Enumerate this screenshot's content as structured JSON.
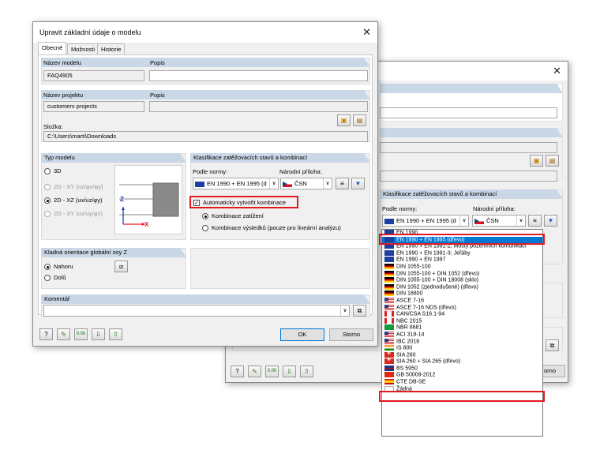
{
  "front": {
    "title": "Upravit základní údaje o modelu",
    "tabs": [
      "Obecné",
      "Možnosti",
      "Historie"
    ],
    "model_name_label": "Název modelu",
    "model_name_value": "FAQ4905",
    "description_label": "Popis",
    "project_name_label": "Název projektu",
    "project_name_value": "customers projects",
    "project_desc_label": "Popis",
    "folder_label": "Složka:",
    "folder_value": "C:\\Users\\marti\\Downloads",
    "model_type_header": "Typ modelu",
    "model_types": [
      "3D",
      "2D - XY (uₓ/uᵧ/φᵣ)",
      "2D - XZ (uₓ/uₓ/φᵧ)",
      "2D - XY (uₓ/uᵧ/φᵣ)"
    ],
    "model_types_display": [
      "3D",
      "2D - XY (uz/φx/φy)",
      "2D - XZ (ux/uz/φy)",
      "2D - XY (ux/uy/φz)"
    ],
    "classification_header": "Klasifikace zatěžovacích stavů a kombinací",
    "standard_label": "Podle normy:",
    "standard_value": "EN 1990 + EN 1995 (d",
    "annex_label": "Národní příloha:",
    "annex_value": "ČSN",
    "auto_combo_label": "Automaticky vytvořit kombinace",
    "combo_options": [
      "Kombinace zatížení",
      "Kombinace výsledků (pouze pro lineární analýzu)"
    ],
    "axis_header": "Kladná orientace globální osy Z",
    "axis_options": [
      "Nahoru",
      "Dolů"
    ],
    "comment_header": "Komentář",
    "ok": "OK",
    "cancel": "Storno",
    "axis_z": "Z",
    "axis_x": "X"
  },
  "back": {
    "classification_header": "Klasifikace zatěžovacích stavů a kombinací",
    "standard_label": "Podle normy:",
    "standard_value": "EN 1990 + EN 1995 (d",
    "annex_label": "Národní příloha:",
    "annex_value": "ČSN",
    "cancel_fragment": "orno"
  },
  "dropdown": [
    {
      "flag": "EU",
      "label": "EN 1990"
    },
    {
      "flag": "EU",
      "label": "EN 1990 + EN 1995 (dřevo)",
      "selected": true
    },
    {
      "flag": "EU",
      "label": "EN 1990 + EN 1991-2; Mosty pozemních komunikací"
    },
    {
      "flag": "EU",
      "label": "EN 1990 + EN 1991-3; Jeřáby"
    },
    {
      "flag": "EU",
      "label": "EN 1990 + EN 1997"
    },
    {
      "flag": "DE",
      "label": "DIN 1055-100"
    },
    {
      "flag": "DE",
      "label": "DIN 1055-100 + DIN 1052 (dřevo)"
    },
    {
      "flag": "DE",
      "label": "DIN 1055-100 + DIN 18008 (sklo)"
    },
    {
      "flag": "DE",
      "label": "DIN 1052 (zjednodušené) (dřevo)"
    },
    {
      "flag": "DE",
      "label": "DIN 18800"
    },
    {
      "flag": "US",
      "label": "ASCE 7-16"
    },
    {
      "flag": "US",
      "label": "ASCE 7-16 NDS (dřevo)"
    },
    {
      "flag": "CA",
      "label": "CAN/CSA S16.1-94"
    },
    {
      "flag": "CA",
      "label": "NBC 2015"
    },
    {
      "flag": "BR",
      "label": "NBR 8681"
    },
    {
      "flag": "US",
      "label": "ACI 318-14"
    },
    {
      "flag": "US",
      "label": "IBC 2018"
    },
    {
      "flag": "IN",
      "label": "IS 800"
    },
    {
      "flag": "CH",
      "label": "SIA 260"
    },
    {
      "flag": "CH",
      "label": "SIA 260 + SIA 265 (dřevo)"
    },
    {
      "flag": "GB",
      "label": "BS 5950"
    },
    {
      "flag": "CN",
      "label": "GB 50009-2012"
    },
    {
      "flag": "ES",
      "label": "CTE DB-SE"
    },
    {
      "flag": "NO",
      "label": "Žádná"
    }
  ],
  "colors": {
    "highlight": "#0078d7",
    "annotation": "#e01a22",
    "header": "#c9d7e6"
  }
}
